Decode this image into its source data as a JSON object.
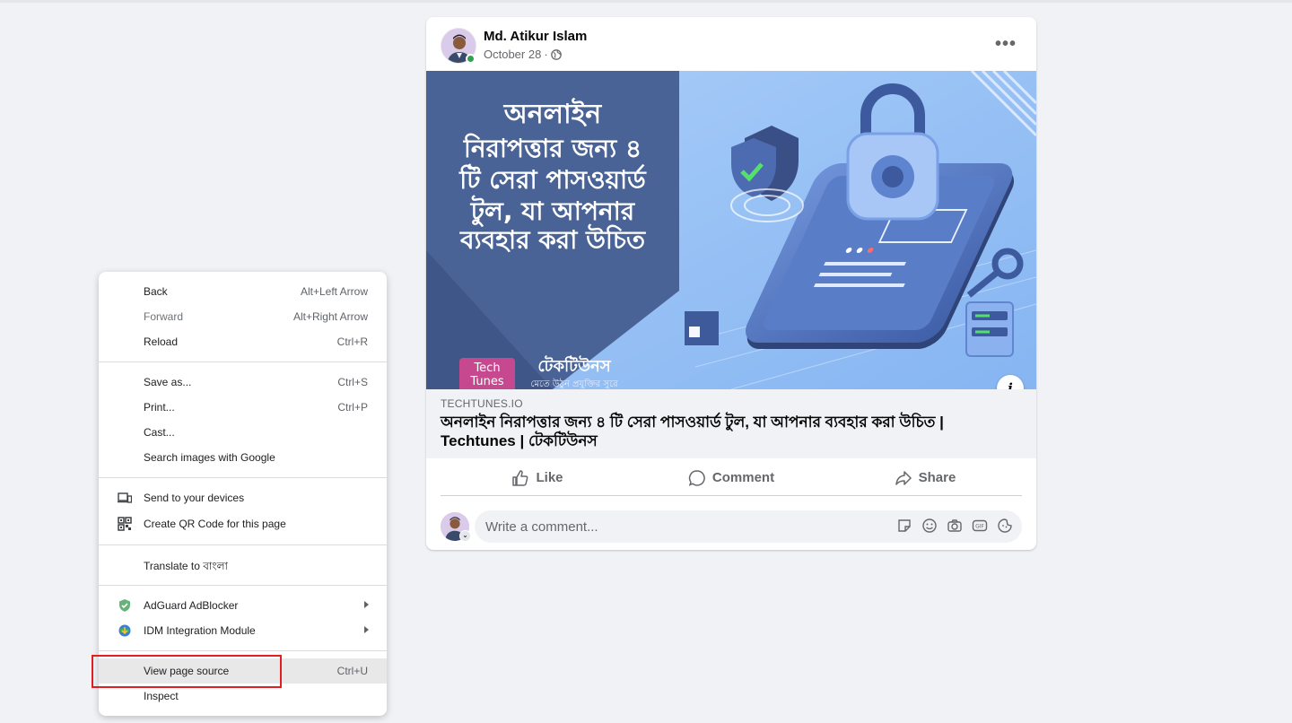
{
  "post": {
    "author": "Md. Atikur Islam",
    "date": "October 28",
    "meta_separator": "·",
    "privacy_icon": "globe-icon",
    "more_label": "•••",
    "image": {
      "headline": "অনলাইন নিরাপত্তার জন্য ৪ টি সেরা পাসওয়ার্ড টুল, যা আপনার ব্যবহার করা উচিত",
      "brand_logo": "Tech Tunes",
      "brand_name": "টেকটিউনস",
      "brand_tagline": "মেতে উঠুন প্রযুক্তির সুরে"
    },
    "info_label": "i",
    "link": {
      "domain": "TECHTUNES.IO",
      "title": "অনলাইন নিরাপত্তার জন্য ৪ টি সেরা পাসওয়ার্ড টুল, যা আপনার ব্যবহার করা উচিত | Techtunes | টেকটিউনস"
    },
    "actions": {
      "like": "Like",
      "comment": "Comment",
      "share": "Share"
    },
    "comment_placeholder": "Write a comment...",
    "comment_avatar_chevron": "⌄",
    "comment_tools": [
      "sticker-icon",
      "emoji-icon",
      "camera-icon",
      "gif-icon",
      "avatar-sticker-icon"
    ],
    "colors": {
      "online": "#31a24c",
      "secondary_text": "#65676b"
    }
  },
  "context_menu": {
    "items": [
      {
        "label": "Back",
        "shortcut": "Alt+Left Arrow"
      },
      {
        "label": "Forward",
        "shortcut": "Alt+Right Arrow",
        "disabled": true
      },
      {
        "label": "Reload",
        "shortcut": "Ctrl+R"
      },
      {
        "label": "Save as...",
        "shortcut": "Ctrl+S"
      },
      {
        "label": "Print...",
        "shortcut": "Ctrl+P"
      },
      {
        "label": "Cast...",
        "shortcut": ""
      },
      {
        "label": "Search images with Google",
        "shortcut": ""
      },
      {
        "label": "Send to your devices",
        "icon": "devices-icon"
      },
      {
        "label": "Create QR Code for this page",
        "icon": "qr-code-icon"
      },
      {
        "label": "Translate to বাংলা"
      },
      {
        "label": "AdGuard AdBlocker",
        "icon": "adguard-icon",
        "submenu": true
      },
      {
        "label": "IDM Integration Module",
        "icon": "idm-icon",
        "submenu": true
      },
      {
        "label": "View page source",
        "shortcut": "Ctrl+U",
        "highlighted": true
      },
      {
        "label": "Inspect"
      }
    ],
    "highlight_color": "#e02020"
  }
}
